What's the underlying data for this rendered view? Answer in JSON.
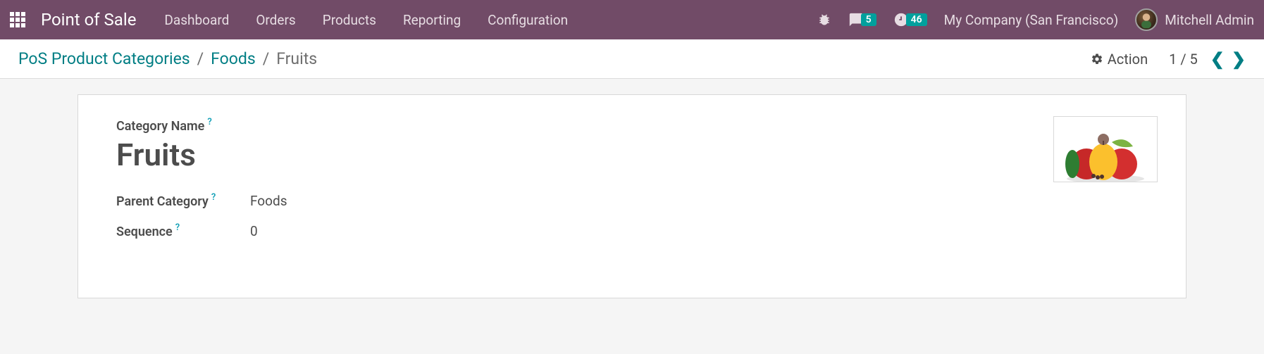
{
  "navbar": {
    "brand": "Point of Sale",
    "links": [
      "Dashboard",
      "Orders",
      "Products",
      "Reporting",
      "Configuration"
    ],
    "messages_badge": "5",
    "activities_badge": "46",
    "company": "My Company (San Francisco)",
    "user": "Mitchell Admin"
  },
  "control": {
    "breadcrumb_root": "PoS Product Categories",
    "breadcrumb_parent": "Foods",
    "breadcrumb_current": "Fruits",
    "action_label": "Action",
    "pager_text": "1 / 5"
  },
  "form": {
    "category_name_label": "Category Name",
    "category_name_value": "Fruits",
    "parent_category_label": "Parent Category",
    "parent_category_value": "Foods",
    "sequence_label": "Sequence",
    "sequence_value": "0"
  }
}
